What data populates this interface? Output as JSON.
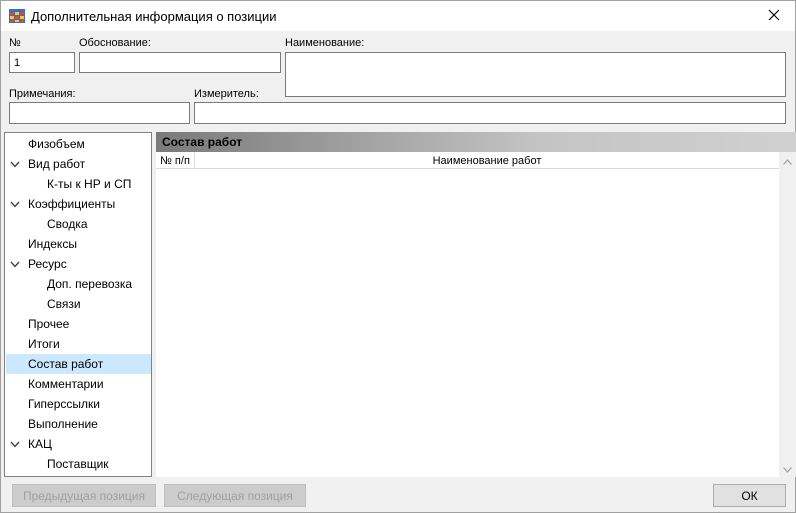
{
  "window": {
    "title": "Дополнительная информация о позиции",
    "app_icon": "spreadsheet-app-icon",
    "close_icon": "close-icon"
  },
  "form": {
    "number_label": "№",
    "number_value": "1",
    "basis_label": "Обоснование:",
    "basis_value": "",
    "name_label": "Наименование:",
    "name_value": "",
    "notes_label": "Примечания:",
    "notes_value": "",
    "unit_label": "Измеритель:",
    "unit_value": ""
  },
  "tree": {
    "items": [
      {
        "label": "Физобъем",
        "level": 0,
        "expandable": false,
        "selected": false
      },
      {
        "label": "Вид работ",
        "level": 0,
        "expandable": true,
        "selected": false
      },
      {
        "label": "К-ты к НР и СП",
        "level": 1,
        "expandable": false,
        "selected": false
      },
      {
        "label": "Коэффициенты",
        "level": 0,
        "expandable": true,
        "selected": false
      },
      {
        "label": "Сводка",
        "level": 1,
        "expandable": false,
        "selected": false
      },
      {
        "label": "Индексы",
        "level": 0,
        "expandable": false,
        "selected": false
      },
      {
        "label": "Ресурс",
        "level": 0,
        "expandable": true,
        "selected": false
      },
      {
        "label": "Доп. перевозка",
        "level": 1,
        "expandable": false,
        "selected": false
      },
      {
        "label": "Связи",
        "level": 1,
        "expandable": false,
        "selected": false
      },
      {
        "label": "Прочее",
        "level": 0,
        "expandable": false,
        "selected": false
      },
      {
        "label": "Итоги",
        "level": 0,
        "expandable": false,
        "selected": false
      },
      {
        "label": "Состав работ",
        "level": 0,
        "expandable": false,
        "selected": true
      },
      {
        "label": "Комментарии",
        "level": 0,
        "expandable": false,
        "selected": false
      },
      {
        "label": "Гиперссылки",
        "level": 0,
        "expandable": false,
        "selected": false
      },
      {
        "label": "Выполнение",
        "level": 0,
        "expandable": false,
        "selected": false
      },
      {
        "label": "КАЦ",
        "level": 0,
        "expandable": true,
        "selected": false
      },
      {
        "label": "Поставщик",
        "level": 1,
        "expandable": false,
        "selected": false
      }
    ]
  },
  "panel": {
    "title": "Состав работ",
    "columns": [
      "№ п/п",
      "Наименование работ"
    ],
    "rows": []
  },
  "buttons": {
    "prev_label": "Предыдущая позиция",
    "next_label": "Следующая позиция",
    "ok_label": "ОК"
  },
  "colors": {
    "selection": "#cce8ff",
    "panel_header_start": "#7a7a7a",
    "panel_header_end": "#d0d0d0"
  }
}
